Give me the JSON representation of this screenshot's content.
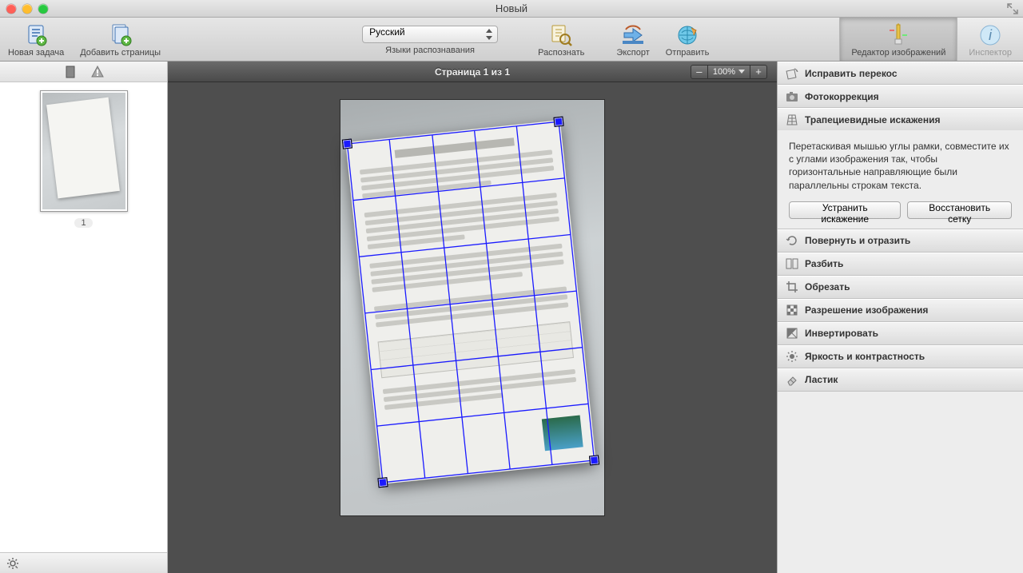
{
  "window": {
    "title": "Новый"
  },
  "toolbar": {
    "new_task": "Новая задача",
    "add_pages": "Добавить страницы",
    "lang_value": "Русский",
    "lang_label": "Языки распознавания",
    "recognize": "Распознать",
    "export": "Экспорт",
    "send": "Отправить",
    "image_editor": "Редактор изображений",
    "inspector": "Инспектор"
  },
  "canvas": {
    "page_indicator": "Страница 1 из 1",
    "zoom_minus": "–",
    "zoom_value": "100%",
    "zoom_plus": "+"
  },
  "thumb": {
    "label": "1"
  },
  "panel": {
    "deskew": "Исправить перекос",
    "photo_correction": "Фотокоррекция",
    "trapezoid": "Трапециевидные искажения",
    "trapezoid_help": "Перетаскивая мышью углы рамки, совместите их с углами изображения так, чтобы горизонтальные направляющие были параллельны строкам текста.",
    "fix_btn": "Устранить искажение",
    "reset_btn": "Восстановить сетку",
    "rotate_flip": "Повернуть и отразить",
    "split": "Разбить",
    "crop": "Обрезать",
    "resolution": "Разрешение изображения",
    "invert": "Инвертировать",
    "brightness": "Яркость и контрастность",
    "eraser": "Ластик"
  }
}
